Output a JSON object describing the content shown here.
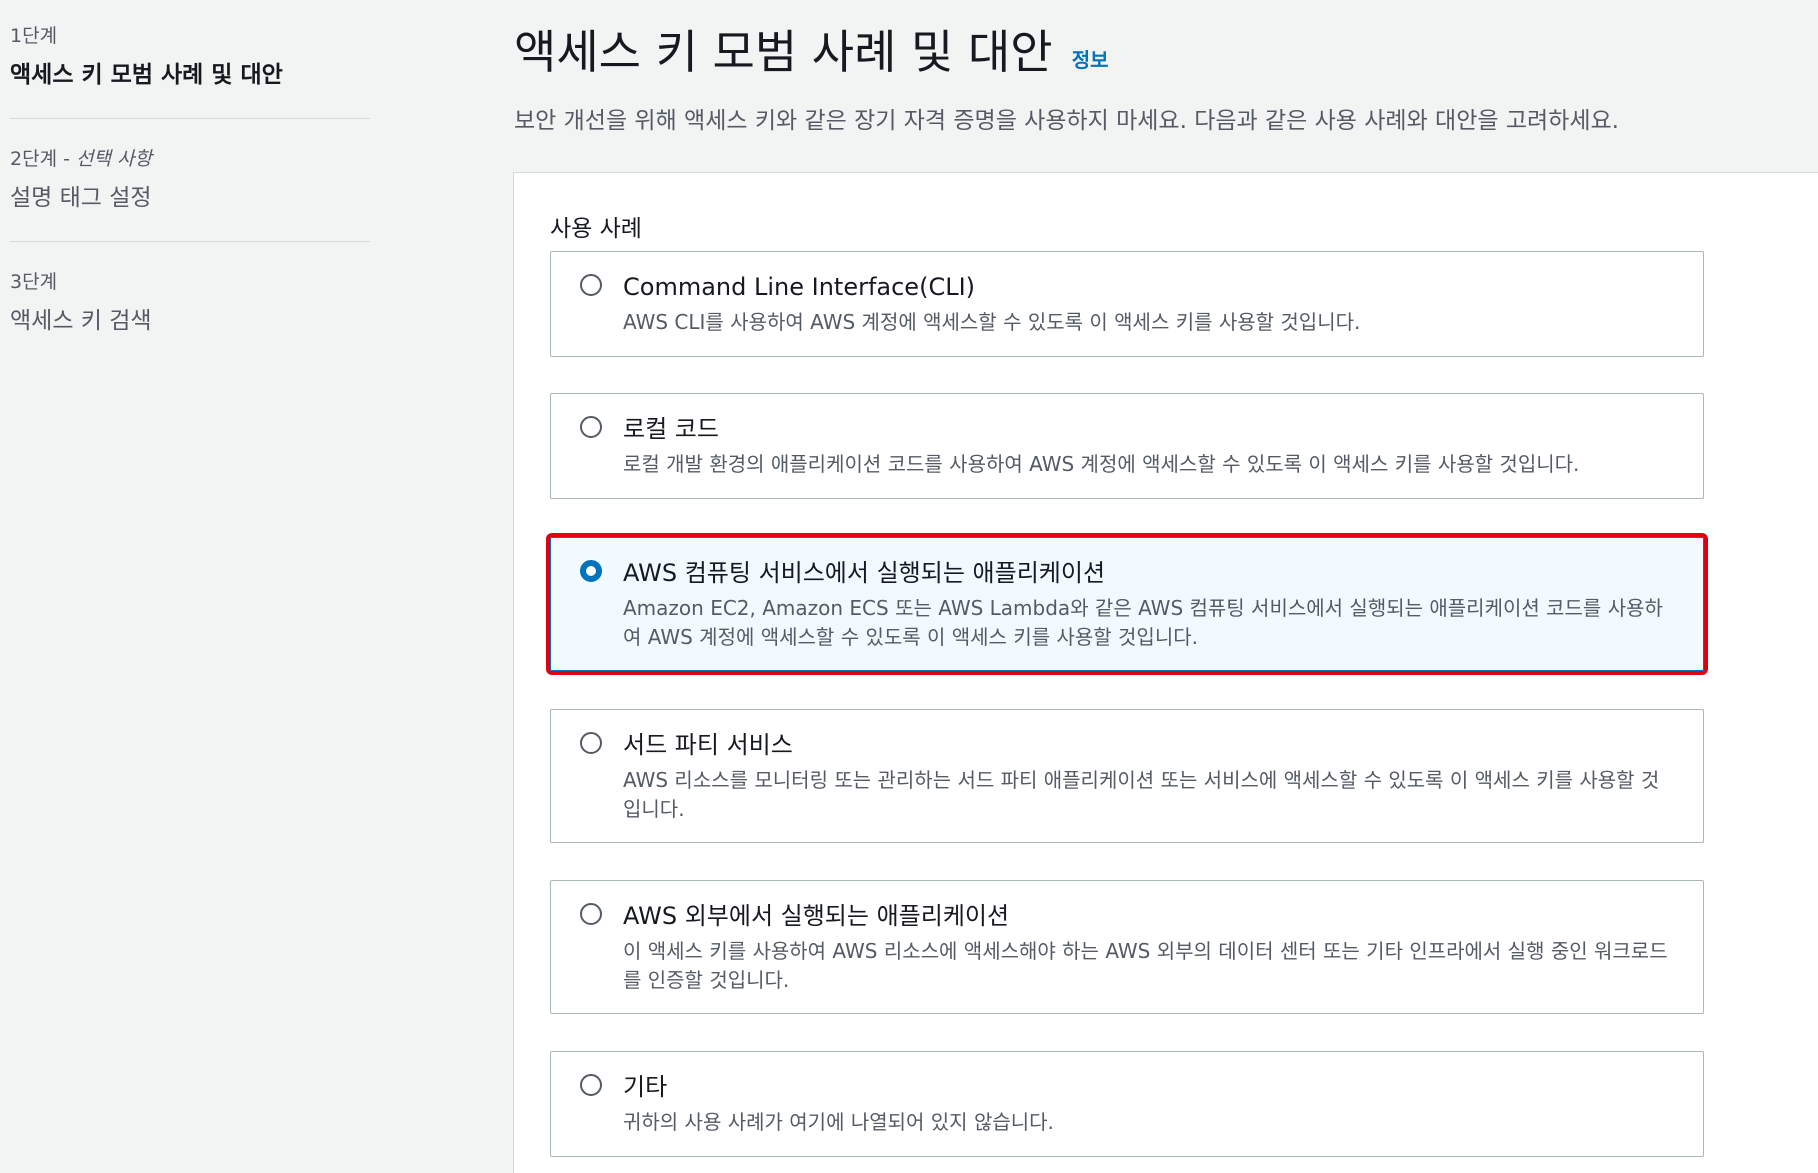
{
  "sidebar": {
    "steps": [
      {
        "number": "1단계",
        "optional": "",
        "title": "액세스 키 모범 사례 및 대안"
      },
      {
        "number": "2단계 - ",
        "optional": "선택 사항",
        "title": "설명 태그 설정"
      },
      {
        "number": "3단계",
        "optional": "",
        "title": "액세스 키 검색"
      }
    ]
  },
  "header": {
    "title": "액세스 키 모범 사례 및 대안",
    "info": "정보",
    "description": "보안 개선을 위해 액세스 키와 같은 장기 자격 증명을 사용하지 마세요. 다음과 같은 사용 사례와 대안을 고려하세요."
  },
  "use_cases": {
    "label": "사용 사례",
    "selected_index": 2,
    "options": [
      {
        "label": "Command Line Interface(CLI)",
        "description": "AWS CLI를 사용하여 AWS 계정에 액세스할 수 있도록 이 액세스 키를 사용할 것입니다."
      },
      {
        "label": "로컬 코드",
        "description": "로컬 개발 환경의 애플리케이션 코드를 사용하여 AWS 계정에 액세스할 수 있도록 이 액세스 키를 사용할 것입니다."
      },
      {
        "label": "AWS 컴퓨팅 서비스에서 실행되는 애플리케이션",
        "description": "Amazon EC2, Amazon ECS 또는 AWS Lambda와 같은 AWS 컴퓨팅 서비스에서 실행되는 애플리케이션 코드를 사용하여 AWS 계정에 액세스할 수 있도록 이 액세스 키를 사용할 것입니다."
      },
      {
        "label": "서드 파티 서비스",
        "description": "AWS 리소스를 모니터링 또는 관리하는 서드 파티 애플리케이션 또는 서비스에 액세스할 수 있도록 이 액세스 키를 사용할 것입니다."
      },
      {
        "label": "AWS 외부에서 실행되는 애플리케이션",
        "description": "이 액세스 키를 사용하여 AWS 리소스에 액세스해야 하는 AWS 외부의 데이터 센터 또는 기타 인프라에서 실행 중인 워크로드를 인증할 것입니다."
      },
      {
        "label": "기타",
        "description": "귀하의 사용 사례가 여기에 나열되어 있지 않습니다."
      }
    ]
  },
  "colors": {
    "accent": "#0073bb",
    "highlight": "#e0000f",
    "selected_bg": "#f1faff"
  }
}
